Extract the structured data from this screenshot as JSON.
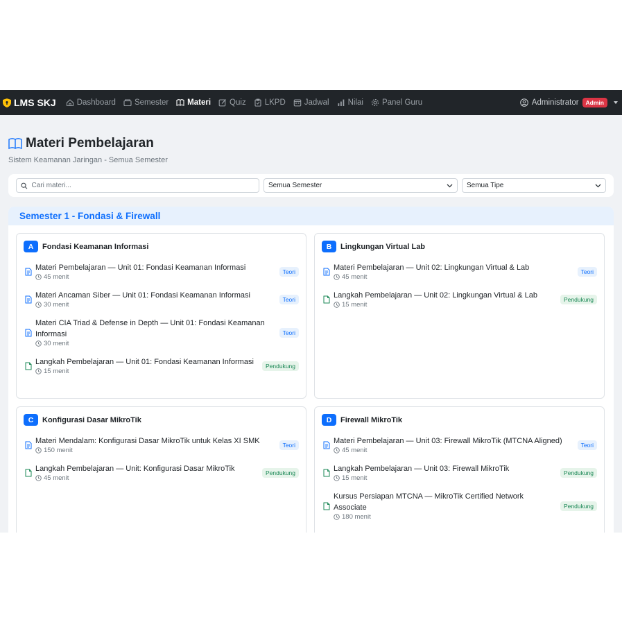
{
  "navbar": {
    "brand": "LMS SKJ",
    "items": [
      {
        "label": "Dashboard",
        "icon": "home-icon"
      },
      {
        "label": "Semester",
        "icon": "folder-icon"
      },
      {
        "label": "Materi",
        "icon": "book-icon",
        "active": true
      },
      {
        "label": "Quiz",
        "icon": "edit-icon"
      },
      {
        "label": "LKPD",
        "icon": "clipboard-icon"
      },
      {
        "label": "Jadwal",
        "icon": "calendar-icon"
      },
      {
        "label": "Nilai",
        "icon": "bar-chart-icon"
      },
      {
        "label": "Panel Guru",
        "icon": "gear-icon"
      }
    ],
    "user": "Administrator",
    "role_badge": "Admin"
  },
  "header": {
    "title": "Materi Pembelajaran",
    "subtitle": "Sistem Keamanan Jaringan - Semua Semester"
  },
  "filters": {
    "search_placeholder": "Cari materi...",
    "semester_value": "Semua Semester",
    "type_value": "Semua Tipe"
  },
  "semester": {
    "title": "Semester 1 - Fondasi & Firewall",
    "units": [
      {
        "letter": "A",
        "title": "Fondasi Keamanan Informasi",
        "items": [
          {
            "title": "Materi Pembelajaran — Unit 01: Fondasi Keamanan Informasi",
            "duration": "45 menit",
            "tag": "Teori",
            "kind": "teori"
          },
          {
            "title": "Materi Ancaman Siber — Unit 01: Fondasi Keamanan Informasi",
            "duration": "30 menit",
            "tag": "Teori",
            "kind": "teori"
          },
          {
            "title": "Materi CIA Triad & Defense in Depth — Unit 01: Fondasi Keamanan Informasi",
            "duration": "30 menit",
            "tag": "Teori",
            "kind": "teori"
          },
          {
            "title": "Langkah Pembelajaran — Unit 01: Fondasi Keamanan Informasi",
            "duration": "15 menit",
            "tag": "Pendukung",
            "kind": "pendukung"
          }
        ]
      },
      {
        "letter": "B",
        "title": "Lingkungan Virtual Lab",
        "items": [
          {
            "title": "Materi Pembelajaran — Unit 02: Lingkungan Virtual & Lab",
            "duration": "45 menit",
            "tag": "Teori",
            "kind": "teori"
          },
          {
            "title": "Langkah Pembelajaran — Unit 02: Lingkungan Virtual & Lab",
            "duration": "15 menit",
            "tag": "Pendukung",
            "kind": "pendukung"
          }
        ]
      },
      {
        "letter": "C",
        "title": "Konfigurasi Dasar MikroTik",
        "items": [
          {
            "title": "Materi Mendalam: Konfigurasi Dasar MikroTik untuk Kelas XI SMK",
            "duration": "150 menit",
            "tag": "Teori",
            "kind": "teori"
          },
          {
            "title": "Langkah Pembelajaran — Unit: Konfigurasi Dasar MikroTik",
            "duration": "45 menit",
            "tag": "Pendukung",
            "kind": "pendukung"
          }
        ]
      },
      {
        "letter": "D",
        "title": "Firewall MikroTik",
        "items": [
          {
            "title": "Materi Pembelajaran — Unit 03: Firewall MikroTik (MTCNA Aligned)",
            "duration": "45 menit",
            "tag": "Teori",
            "kind": "teori"
          },
          {
            "title": "Langkah Pembelajaran — Unit 03: Firewall MikroTik",
            "duration": "15 menit",
            "tag": "Pendukung",
            "kind": "pendukung"
          },
          {
            "title": "Kursus Persiapan MTCNA — MikroTik Certified Network Associate",
            "duration": "180 menit",
            "tag": "Pendukung",
            "kind": "pendukung"
          }
        ]
      }
    ]
  },
  "colors": {
    "accent": "#0d6efd",
    "navbar_bg": "#212529",
    "danger": "#dc3545",
    "success": "#198754"
  }
}
